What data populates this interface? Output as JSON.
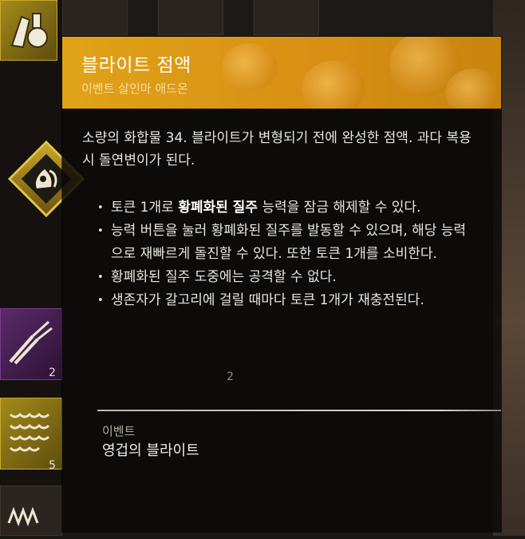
{
  "tooltip": {
    "title": "블라이트 점액",
    "subtitle": "이벤트 살인마 애드온",
    "description": "소량의 화합물 34. 블라이트가 변형되기 전에 완성한 점액. 과다 복용 시 돌연변이가 된다.",
    "bullets": [
      {
        "pre": "토큰 1개로 ",
        "bold": "황폐화된 질주",
        "post": " 능력을 잠금 해제할 수 있다."
      },
      {
        "pre": "능력 버튼을 눌러 황폐화된 질주를 발동할 수 있으며, 해당 능력으로 재빠르게 돌진할 수 있다. 또한 토큰 1개를 소비한다.",
        "bold": "",
        "post": ""
      },
      {
        "pre": "황폐화된 질주 도중에는 공격할 수 없다.",
        "bold": "",
        "post": ""
      },
      {
        "pre": "생존자가 갈고리에 걸릴 때마다 토큰 1개가 재충전된다.",
        "bold": "",
        "post": ""
      }
    ],
    "category_label": "이벤트",
    "collection_name": "영겁의 블라이트",
    "bullet_glyph": "•"
  },
  "inventory": {
    "counts": {
      "pliers": "2",
      "middle": "2",
      "springs": "5"
    },
    "icons": [
      "medicine-icon",
      "herb-syringe-icon",
      "pliers-icon",
      "springs-icon",
      "wire-icon",
      "gloves-icon",
      "bag-icon",
      "skull-icon"
    ]
  },
  "colors": {
    "header_accent": "#e0a318",
    "rare_yellow": "#a48a1a",
    "very_rare_purple": "#5b2a6a"
  }
}
